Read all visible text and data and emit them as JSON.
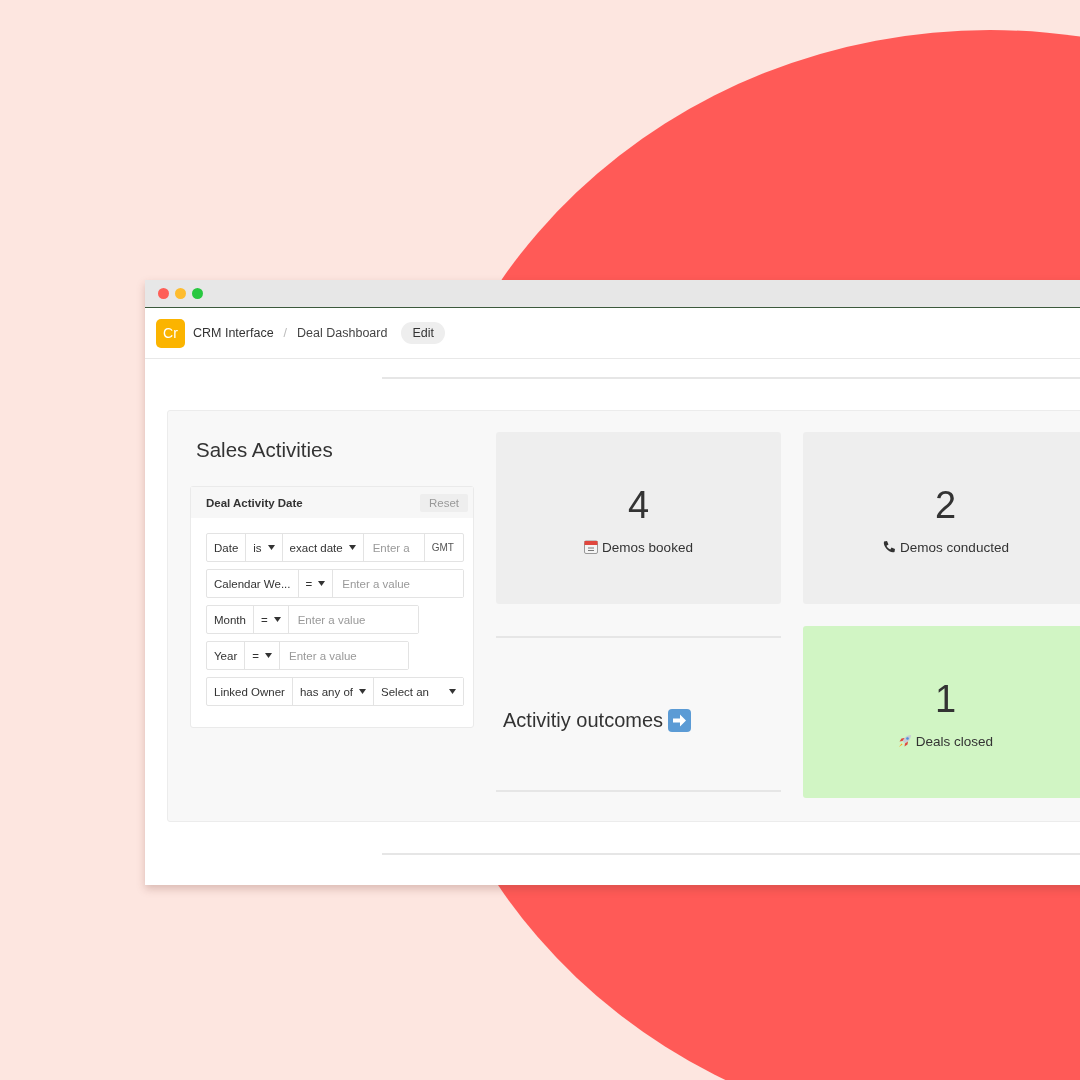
{
  "window": {
    "controls": [
      {
        "color": "#fe5f57"
      },
      {
        "color": "#febc2e"
      },
      {
        "color": "#28c840"
      }
    ]
  },
  "header": {
    "logo": "Cr",
    "app": "CRM Interface",
    "separator": "/",
    "page": "Deal Dashboard",
    "edit_button": "Edit"
  },
  "section": {
    "title": "Sales Activities"
  },
  "filter": {
    "title": "Deal Activity Date",
    "reset_button": "Reset",
    "rows": [
      {
        "segments": [
          {
            "kind": "label",
            "text": "Date"
          },
          {
            "kind": "select",
            "text": "is"
          },
          {
            "kind": "select",
            "text": "exact date"
          },
          {
            "kind": "input",
            "placeholder": "Enter a"
          },
          {
            "kind": "suffix",
            "text": "GMT"
          }
        ]
      },
      {
        "segments": [
          {
            "kind": "label",
            "text": "Calendar We..."
          },
          {
            "kind": "select",
            "text": "="
          },
          {
            "kind": "input",
            "placeholder": "Enter a value"
          }
        ]
      },
      {
        "segments": [
          {
            "kind": "label",
            "text": "Month"
          },
          {
            "kind": "select",
            "text": "="
          },
          {
            "kind": "input",
            "placeholder": "Enter a value"
          }
        ]
      },
      {
        "segments": [
          {
            "kind": "label",
            "text": "Year"
          },
          {
            "kind": "select",
            "text": "="
          },
          {
            "kind": "input",
            "placeholder": "Enter a value"
          }
        ]
      },
      {
        "segments": [
          {
            "kind": "label",
            "text": "Linked Owner"
          },
          {
            "kind": "select",
            "text": "has any of"
          },
          {
            "kind": "select",
            "text": "Select an"
          }
        ]
      }
    ]
  },
  "stats": [
    {
      "value": "4",
      "label": "Demos booked",
      "color": "#eeeeee"
    },
    {
      "value": "2",
      "label": "Demos conducted",
      "color": "#eeeeee"
    },
    {
      "value": "1",
      "label": "Deals closed",
      "color": "#d1f5c4"
    }
  ],
  "outcomes": {
    "title": "Activitiy outcomes"
  }
}
